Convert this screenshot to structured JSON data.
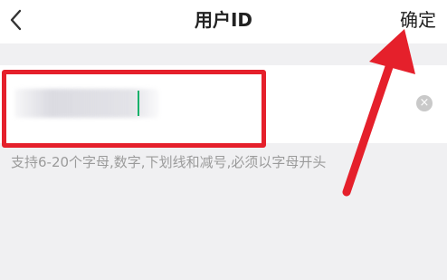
{
  "header": {
    "back_icon": "chevron-left-icon",
    "title": "用户ID",
    "confirm_label": "确定"
  },
  "input": {
    "clear_icon": "clear-circle-icon",
    "clear_glyph": "×"
  },
  "hint": "支持6-20个字母,数字,下划线和减号,必须以字母开头",
  "annotation": {
    "highlight_color": "#e5202b",
    "arrow_color": "#e5202b"
  }
}
